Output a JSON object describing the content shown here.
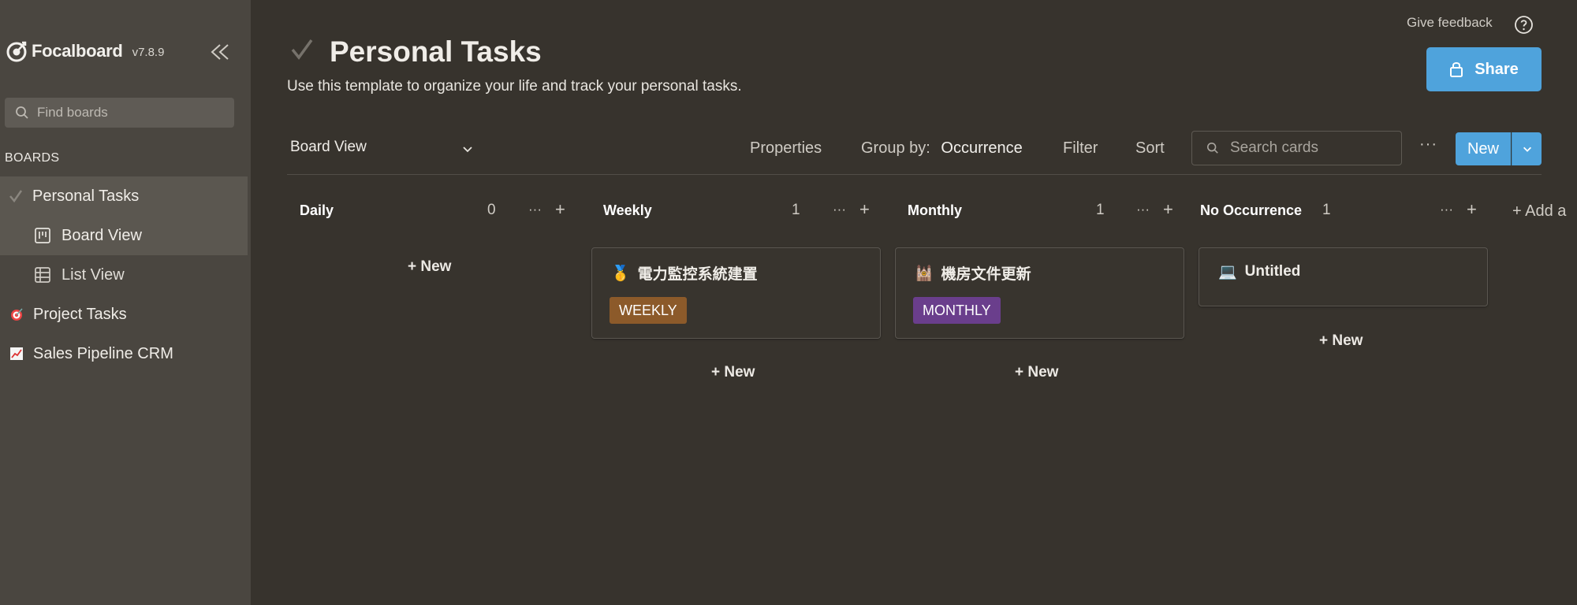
{
  "app": {
    "name": "Focalboard",
    "version": "v7.8.9"
  },
  "sidebar": {
    "search_placeholder": "Find boards",
    "section_label": "BOARDS",
    "items": [
      {
        "label": "Personal Tasks",
        "icon": "check-icon",
        "selected": true
      },
      {
        "label": "Board View",
        "icon": "board-icon",
        "selected": true
      },
      {
        "label": "List View",
        "icon": "table-icon",
        "selected": false
      },
      {
        "label": "Project Tasks",
        "icon": "dart-icon",
        "selected": false
      },
      {
        "label": "Sales Pipeline CRM",
        "icon": "chart-icon",
        "selected": false
      }
    ]
  },
  "header": {
    "feedback": "Give feedback",
    "share": "Share",
    "title": "Personal Tasks",
    "description": "Use this template to organize your life and track your personal tasks."
  },
  "toolbar": {
    "view": "Board View",
    "properties": "Properties",
    "group_by_label": "Group by:",
    "group_by_value": "Occurrence",
    "filter": "Filter",
    "sort": "Sort",
    "search_placeholder": "Search cards",
    "more": "···",
    "new": "New"
  },
  "columns": [
    {
      "name": "Daily",
      "count": "0",
      "color": "#4d4e8c",
      "cards": [],
      "add": "+ New"
    },
    {
      "name": "Weekly",
      "count": "1",
      "color": "#8c5a2a",
      "cards": [
        {
          "emoji": "🥇",
          "title": "電力監控系統建置",
          "tag": "WEEKLY",
          "tag_color": "#8c5a2a"
        }
      ],
      "add": "+ New"
    },
    {
      "name": "Monthly",
      "count": "1",
      "color": "#6a3e8c",
      "cards": [
        {
          "emoji": "🕍",
          "title": "機房文件更新",
          "tag": "MONTHLY",
          "tag_color": "#6a3e8c"
        }
      ],
      "add": "+ New"
    },
    {
      "name": "No Occurrence",
      "count": "1",
      "color": "",
      "cards": [
        {
          "emoji": "💻",
          "title": "Untitled"
        }
      ],
      "add": "+ New"
    }
  ],
  "add_group": "+ Add a"
}
